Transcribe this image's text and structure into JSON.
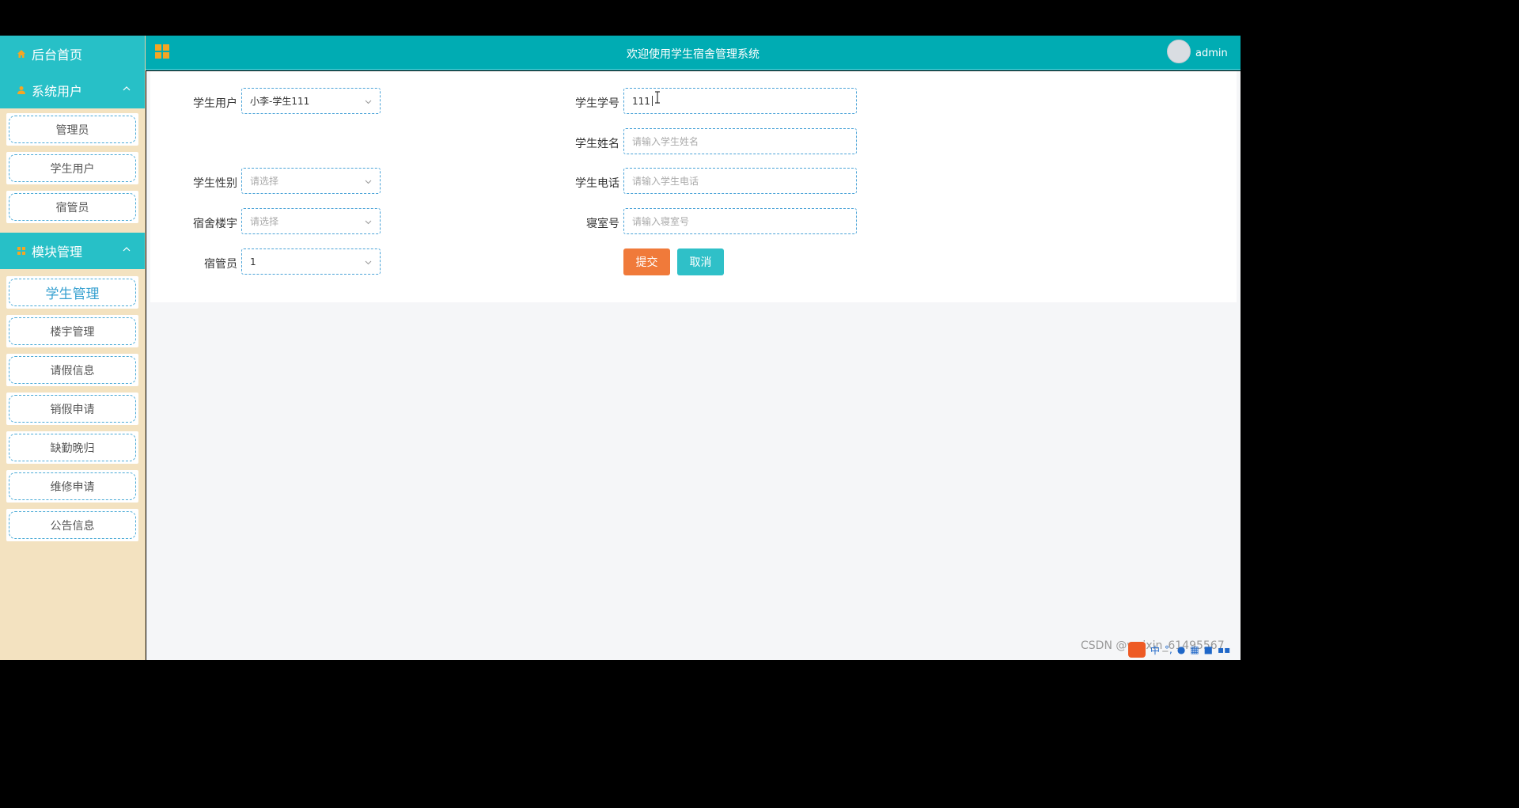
{
  "header": {
    "title": "欢迎使用学生宿舍管理系统",
    "user": "admin",
    "bg_color": "#00acb3"
  },
  "sidebar": {
    "home_label": "后台首页",
    "sections": [
      {
        "label": "系统用户",
        "items": [
          {
            "label": "管理员"
          },
          {
            "label": "学生用户"
          },
          {
            "label": "宿管员"
          }
        ]
      },
      {
        "label": "模块管理",
        "items": [
          {
            "label": "学生管理",
            "active": true
          },
          {
            "label": "楼宇管理"
          },
          {
            "label": "请假信息"
          },
          {
            "label": "销假申请"
          },
          {
            "label": "缺勤晚归"
          },
          {
            "label": "维修申请"
          },
          {
            "label": "公告信息"
          }
        ]
      }
    ]
  },
  "form": {
    "student_user": {
      "label": "学生用户",
      "value": "小李-学生111"
    },
    "student_no": {
      "label": "学生学号",
      "value": "111"
    },
    "student_name": {
      "label": "学生姓名",
      "placeholder": "请输入学生姓名"
    },
    "gender": {
      "label": "学生性别",
      "placeholder": "请选择"
    },
    "phone": {
      "label": "学生电话",
      "placeholder": "请输入学生电话"
    },
    "building": {
      "label": "宿舍楼宇",
      "placeholder": "请选择"
    },
    "room": {
      "label": "寝室号",
      "placeholder": "请输入寝室号"
    },
    "manager": {
      "label": "宿管员",
      "value": "1"
    },
    "submit_label": "提交",
    "cancel_label": "取消",
    "submit_color": "#f07a3a",
    "cancel_color": "#2fc0c8"
  },
  "watermark": "CSDN @weixin_61495567",
  "ime": {
    "lang": "中"
  }
}
